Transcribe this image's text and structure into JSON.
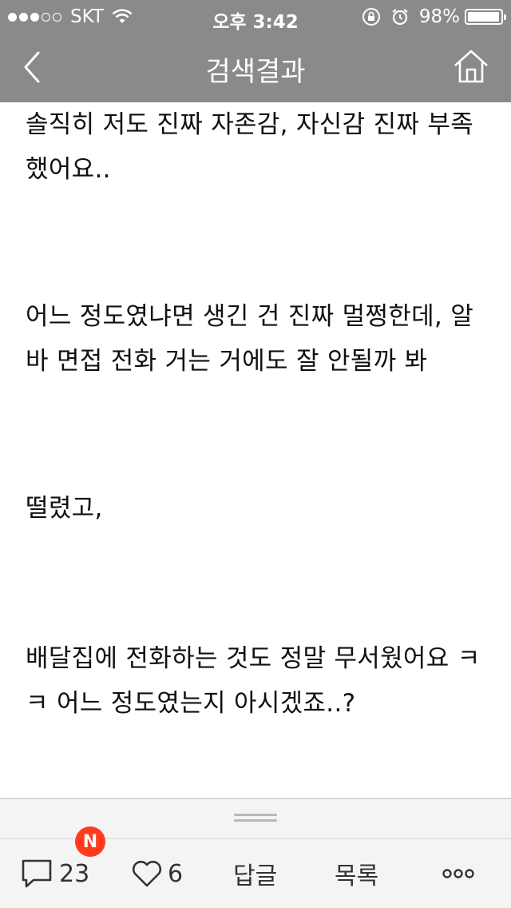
{
  "status_bar": {
    "signal_dots_filled": 3,
    "signal_dots_total": 5,
    "carrier": "SKT",
    "time": "오후 3:42",
    "battery_percent": "98%",
    "battery_level": 0.98,
    "icons": [
      "wifi-icon",
      "orientation-lock-icon",
      "alarm-icon",
      "battery-icon"
    ]
  },
  "header": {
    "title": "검색결과",
    "back_icon": "chevron-left-icon",
    "home_icon": "home-icon",
    "background": "#8a8a8a"
  },
  "content": {
    "paragraphs": [
      "솔직히 저도 진짜 자존감, 자신감 진짜 부족했어요..",
      "어느 정도였냐면 생긴 건 진짜 멀쩡한데, 알바 면접 전화 거는 거에도 잘 안될까 봐",
      "떨렸고,",
      "배달집에 전화하는 것도 정말 무서웠어요 ㅋㅋ 어느 정도였는지 아시겠죠..?"
    ]
  },
  "toolbar": {
    "comment_count": "23",
    "new_badge": "N",
    "badge_color": "#ff3b1f",
    "like_count": "6",
    "reply_label": "답글",
    "list_label": "목록",
    "more_icon": "more-dots-icon"
  }
}
